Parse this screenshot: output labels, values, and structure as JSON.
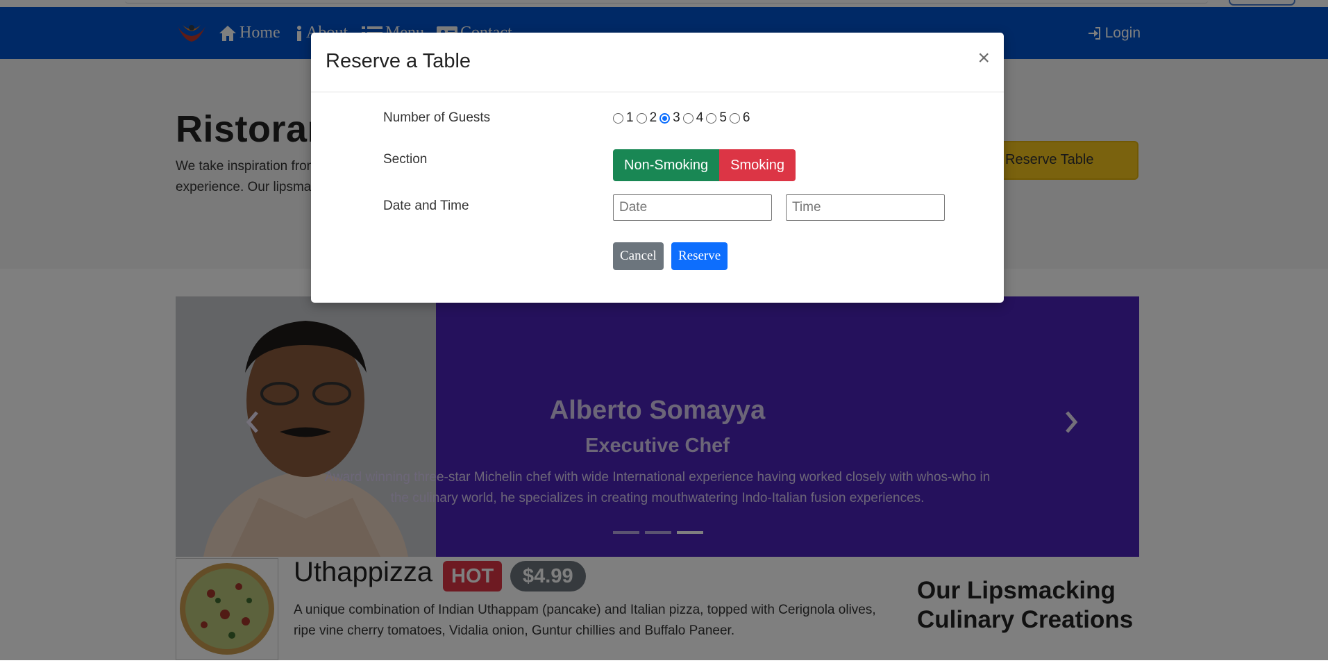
{
  "nav": {
    "home": "Home",
    "about": "About",
    "menu": "Menu",
    "contact": "Contact",
    "login": "Login"
  },
  "jumbotron": {
    "title": "Ristorante con Fusion",
    "lead": "We take inspiration from the World's best cuisines, and create a unique fusion experience. Our lipsmacking creations will tickle your culinary senses!",
    "reserve_button": "Reserve Table"
  },
  "carousel": {
    "name": "Alberto Somayya",
    "role": "Executive Chef",
    "description": "Award winning three-star Michelin chef with wide International experience having worked closely with whos-who in the culinary world, he specializes in creating mouthwatering Indo-Italian fusion experiences.",
    "active_index": 2
  },
  "dish": {
    "name": "Uthappizza",
    "badge": "HOT",
    "price": "$4.99",
    "description": "A unique combination of Indian Uthappam (pancake) and Italian pizza, topped with Cerignola olives, ripe vine cherry tomatoes, Vidalia onion, Guntur chillies and Buffalo Paneer."
  },
  "side_heading": "Our Lipsmacking Culinary Creations",
  "modal": {
    "title": "Reserve a Table",
    "close": "×",
    "guests_label": "Number of Guests",
    "guest_options": [
      "1",
      "2",
      "3",
      "4",
      "5",
      "6"
    ],
    "guests_selected": "3",
    "section_label": "Section",
    "section_nonsmoking": "Non-Smoking",
    "section_smoking": "Smoking",
    "datetime_label": "Date and Time",
    "date_placeholder": "Date",
    "time_placeholder": "Time",
    "cancel": "Cancel",
    "reserve": "Reserve"
  },
  "colors": {
    "navbar": "#0052cc",
    "carousel_bg": "#4b22b8",
    "reserve_btn": "#f4c51c",
    "nonsmoking": "#198754",
    "smoking": "#dc3545",
    "cancel": "#6c757d",
    "primary": "#0d6efd"
  }
}
